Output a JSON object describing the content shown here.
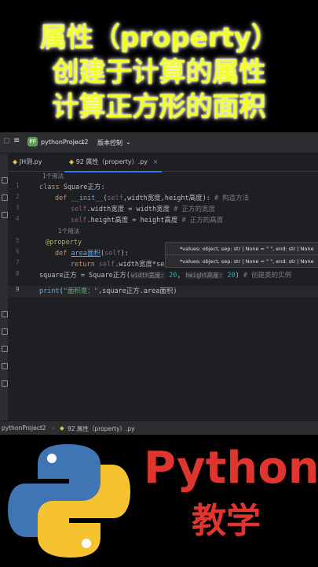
{
  "headline": {
    "line1": "属性（property）",
    "line2": "创建于计算的属性",
    "line3": "计算正方形的面积"
  },
  "ide": {
    "project": "pythonProject2",
    "project_badge": "PP",
    "vcs": "版本控制",
    "tabs": [
      {
        "label": "JH测.py",
        "active": false
      },
      {
        "label": "92 属性（property）.py",
        "active": true
      }
    ],
    "line_numbers": [
      "1",
      "2",
      "3",
      "4",
      "5",
      "6",
      "7",
      "8",
      "9"
    ],
    "code": {
      "hint_usage_1": "1个用法",
      "l1_kw": "class ",
      "l1_name": "Square正方",
      "l1_end": ":",
      "l2_kw": "def ",
      "l2_fn": "__init__",
      "l2_open": "(",
      "l2_self": "self",
      "l2_params": ",width宽度,height高度): ",
      "l2_comment": "# 构造方法",
      "l3_self": "self",
      "l3_rest": ".width宽度 = width宽度 ",
      "l3_comment": "# 正方的宽度",
      "l4_self": "self",
      "l4_rest": ".height高度 = height高度 ",
      "l4_comment": "# 正方的高度",
      "hint_usage_2": "1个用法",
      "l5_dec": "@property",
      "l6_kw": "def ",
      "l6_fn": "area面积",
      "l6_open": "(",
      "l6_self": "self",
      "l6_end": "):",
      "l7_kw": "return ",
      "l7_self": "self",
      "l7_rest": ".width宽度*self.height高度  # 计算正方形的面积",
      "l8_a": "square正方 = Square正方(",
      "l8_hint1": "width宽度:",
      "l8_num1": " 20",
      "l8_b": ", ",
      "l8_hint2": "height高度:",
      "l8_num2": " 20",
      "l8_c": ") ",
      "l8_comment": "# 创建类的实例",
      "l9_fn": "print",
      "l9_open": "(",
      "l9_str": "\"面积是：\"",
      "l9_rest": ",square正方.area面积)"
    },
    "popups": [
      "*values: object, sep: str | None = \" \", end: str | None",
      "*values: object, sep: str | None = \" \", end: str | None"
    ],
    "status_project": "pythonProject2",
    "status_file": "92 属性（property）.py"
  },
  "branding": {
    "python": "Python",
    "teaching": "教学"
  }
}
